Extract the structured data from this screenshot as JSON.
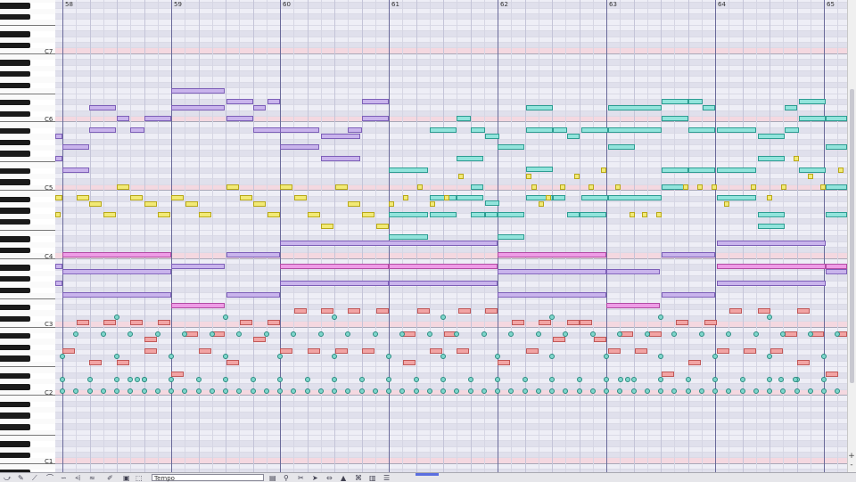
{
  "piano_roll": {
    "octave_labels": [
      "C7",
      "C6",
      "C5",
      "C4",
      "C3",
      "C2",
      "C1"
    ],
    "measures": [
      "58",
      "59",
      "60",
      "61",
      "62",
      "63",
      "64",
      "65"
    ]
  },
  "colors": {
    "purple": "#c9b4ec",
    "purple_border": "#7d5fb8",
    "cyan": "#92e4dc",
    "cyan_border": "#2d9d92",
    "yellow": "#f2ea76",
    "yellow_border": "#b8a818",
    "magenta": "#ee9ce6",
    "magenta_border": "#b24ca4",
    "red": "#f2a4a4",
    "red_border": "#c05858",
    "drum": "#7fd6cc",
    "drum_border": "#2a8c80"
  },
  "toolbar": {
    "tempo_value": "Tempo",
    "icons": [
      "select-tool-icon",
      "pencil-tool-icon",
      "eraser-tool-icon",
      "curve-tool-icon",
      "scissors-tool-icon",
      "marquee-tool-icon",
      "play-icon",
      "note-icon",
      "snap-icon",
      "grid-icon",
      "chart-icon",
      "play-marker-icon"
    ]
  },
  "zoom": {
    "in_label": "+",
    "out_label": "-"
  }
}
